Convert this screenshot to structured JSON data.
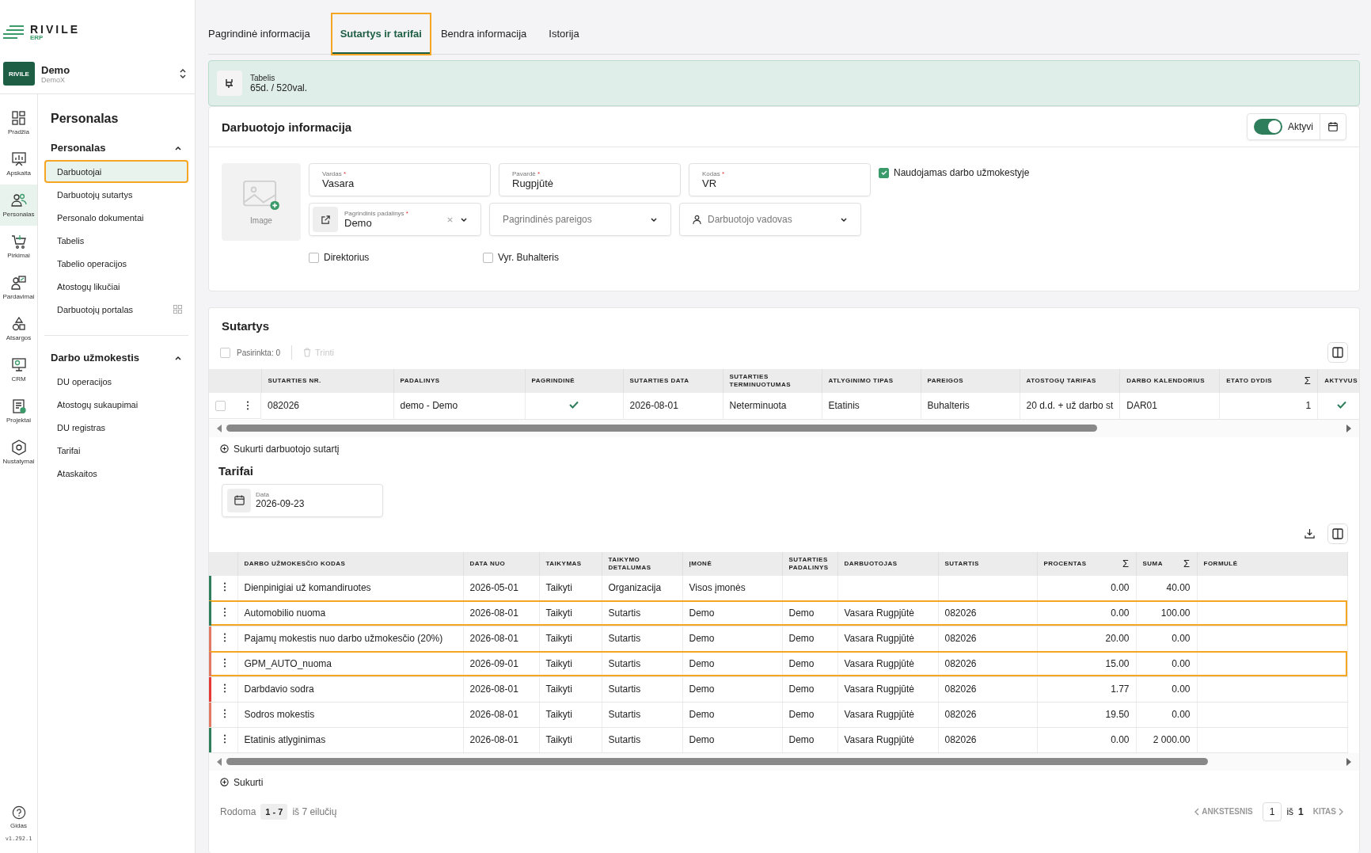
{
  "app": {
    "logo": "RIVILE",
    "logo_sub": "ERP"
  },
  "company": {
    "name": "Demo",
    "sub": "DemoX",
    "badge": "RIVILE"
  },
  "rail": [
    {
      "label": "Pradžia",
      "selected": false
    },
    {
      "label": "Apskaita",
      "selected": false
    },
    {
      "label": "Personalas",
      "selected": true
    },
    {
      "label": "Pirkimai",
      "selected": false
    },
    {
      "label": "Pardavimai",
      "selected": false
    },
    {
      "label": "Atsargos",
      "selected": false
    },
    {
      "label": "CRM",
      "selected": false
    },
    {
      "label": "Projektai",
      "selected": false
    },
    {
      "label": "Nustatymai",
      "selected": false
    }
  ],
  "help": {
    "label": "Gidas",
    "version": "v1.292.1"
  },
  "nav": {
    "title": "Personalas",
    "sections": [
      {
        "title": "Personalas",
        "expanded": true,
        "items": [
          {
            "label": "Darbuotojai",
            "selected": true,
            "highlighted": true,
            "grid_icon": false
          },
          {
            "label": "Darbuotojų sutartys",
            "selected": false,
            "highlighted": false,
            "grid_icon": false
          },
          {
            "label": "Personalo dokumentai",
            "selected": false,
            "highlighted": false,
            "grid_icon": false
          },
          {
            "label": "Tabelis",
            "selected": false,
            "highlighted": false,
            "grid_icon": false
          },
          {
            "label": "Tabelio operacijos",
            "selected": false,
            "highlighted": false,
            "grid_icon": false
          },
          {
            "label": "Atostogų likučiai",
            "selected": false,
            "highlighted": false,
            "grid_icon": false
          },
          {
            "label": "Darbuotojų portalas",
            "selected": false,
            "highlighted": false,
            "grid_icon": true
          }
        ]
      },
      {
        "title": "Darbo užmokestis",
        "expanded": true,
        "items": [
          {
            "label": "DU operacijos",
            "selected": false,
            "highlighted": false,
            "grid_icon": false
          },
          {
            "label": "Atostogų sukaupimai",
            "selected": false,
            "highlighted": false,
            "grid_icon": false
          },
          {
            "label": "DU registras",
            "selected": false,
            "highlighted": false,
            "grid_icon": false
          },
          {
            "label": "Tarifai",
            "selected": false,
            "highlighted": false,
            "grid_icon": false
          },
          {
            "label": "Ataskaitos",
            "selected": false,
            "highlighted": false,
            "grid_icon": false
          }
        ]
      }
    ]
  },
  "tabs": [
    {
      "label": "Pagrindinė informacija",
      "selected": false,
      "highlighted": false
    },
    {
      "label": "Sutartys ir tarifai",
      "selected": true,
      "highlighted": true
    },
    {
      "label": "Bendra informacija",
      "selected": false,
      "highlighted": false
    },
    {
      "label": "Istorija",
      "selected": false,
      "highlighted": false
    }
  ],
  "banner": {
    "title": "Tabelis",
    "value": "65d. / 520val."
  },
  "employee": {
    "title": "Darbuotojo informacija",
    "active_toggle": {
      "label": "Aktyvi",
      "on": true
    },
    "image_label": "Image",
    "fields": [
      {
        "label": "Vardas",
        "mark": "*",
        "value": "Vasara"
      },
      {
        "label": "Pavardė",
        "mark": "*",
        "value": "Rugpjūtė"
      },
      {
        "label": "Kodas",
        "mark": "*",
        "value": "VR"
      }
    ],
    "payroll_checkbox": {
      "label": "Naudojamas darbo užmokestyje",
      "checked": true
    },
    "department": {
      "label": "Pagrindinis padalinys",
      "mark": "*",
      "value": "Demo"
    },
    "position": {
      "placeholder": "Pagrindinės pareigos"
    },
    "manager": {
      "placeholder": "Darbuotojo vadovas"
    },
    "checkboxes": [
      {
        "label": "Direktorius",
        "checked": false
      },
      {
        "label": "Vyr. Buhalteris",
        "checked": false
      }
    ]
  },
  "contracts": {
    "title": "Sutartys",
    "selected_count": "Pasirinkta: 0",
    "select_all": {
      "checked": false
    },
    "delete": {
      "label": "Trinti",
      "disabled": true
    },
    "columns": [
      {
        "label": "SUTARTIES NR."
      },
      {
        "label": "PADALINYS"
      },
      {
        "label": "PAGRINDINĖ"
      },
      {
        "label": "SUTARTIES DATA"
      },
      {
        "label": "SUTARTIES TERMINUOTUMAS"
      },
      {
        "label": "ATLYGINIMO TIPAS"
      },
      {
        "label": "PAREIGOS"
      },
      {
        "label": "ATOSTOGŲ TARIFAS"
      },
      {
        "label": "DARBO KALENDORIUS"
      },
      {
        "label": "ETATO DYDIS",
        "sum_mark": "Σ"
      },
      {
        "label": "AKTYVUS"
      }
    ],
    "rows": [
      {
        "checked": false,
        "number": "082026",
        "department": "demo - Demo",
        "main": true,
        "date": "2026-08-01",
        "term": "Neterminuota",
        "pay_type": "Etatinis",
        "position": "Buhalteris",
        "vacation_rate": "20 d.d. + už darbo st",
        "calendar": "DAR01",
        "fte": "1",
        "active": true
      }
    ],
    "create_link": "Sukurti darbuotojo sutartį"
  },
  "rates": {
    "title": "Tarifai",
    "date_field": {
      "label": "Data",
      "value": "2026-09-23"
    },
    "columns": [
      {
        "label": "DARBO UŽMOKESČIO KODAS"
      },
      {
        "label": "DATA NUO"
      },
      {
        "label": "TAIKYMAS"
      },
      {
        "label": "TAIKYMO DETALUMAS"
      },
      {
        "label": "ĮMONĖ"
      },
      {
        "label": "SUTARTIES PADALINYS"
      },
      {
        "label": "DARBUOTOJAS"
      },
      {
        "label": "SUTARTIS"
      },
      {
        "label": "PROCENTAS",
        "sum_mark": "Σ"
      },
      {
        "label": "SUMA",
        "sum_mark": "Σ"
      },
      {
        "label": "FORMULĖ"
      }
    ],
    "rows": [
      {
        "color": "#2e7d5b",
        "highlighted": false,
        "cells": [
          "Dienpinigiai už komandiruotes",
          "2026-05-01",
          "Taikyti",
          "Organizacija",
          "Visos įmonės",
          "",
          "",
          "",
          "0.00",
          "40.00",
          ""
        ]
      },
      {
        "color": "#2e7d5b",
        "highlighted": true,
        "cells": [
          "Automobilio nuoma",
          "2026-08-01",
          "Taikyti",
          "Sutartis",
          "Demo",
          "Demo",
          "Vasara Rugpjūtė",
          "082026",
          "0.00",
          "100.00",
          ""
        ]
      },
      {
        "color": "#e07a64",
        "highlighted": false,
        "cells": [
          "Pajamų mokestis nuo darbo užmokesčio (20%)",
          "2026-08-01",
          "Taikyti",
          "Sutartis",
          "Demo",
          "Demo",
          "Vasara Rugpjūtė",
          "082026",
          "20.00",
          "0.00",
          ""
        ]
      },
      {
        "color": "#e07a64",
        "highlighted": true,
        "cells": [
          "GPM_AUTO_nuoma",
          "2026-09-01",
          "Taikyti",
          "Sutartis",
          "Demo",
          "Demo",
          "Vasara Rugpjūtė",
          "082026",
          "15.00",
          "0.00",
          ""
        ]
      },
      {
        "color": "#e53935",
        "highlighted": false,
        "cells": [
          "Darbdavio sodra",
          "2026-08-01",
          "Taikyti",
          "Sutartis",
          "Demo",
          "Demo",
          "Vasara Rugpjūtė",
          "082026",
          "1.77",
          "0.00",
          ""
        ]
      },
      {
        "color": "#e07a64",
        "highlighted": false,
        "cells": [
          "Sodros mokestis",
          "2026-08-01",
          "Taikyti",
          "Sutartis",
          "Demo",
          "Demo",
          "Vasara Rugpjūtė",
          "082026",
          "19.50",
          "0.00",
          ""
        ]
      },
      {
        "color": "#2e7d5b",
        "highlighted": false,
        "cells": [
          "Etatinis atlyginimas",
          "2026-08-01",
          "Taikyti",
          "Sutartis",
          "Demo",
          "Demo",
          "Vasara Rugpjūtė",
          "082026",
          "0.00",
          "2 000.00",
          ""
        ]
      }
    ],
    "create_link": "Sukurti",
    "pagination": {
      "showing": "Rodoma",
      "range": "1 - 7",
      "total": "iš 7 eilučių",
      "prev": {
        "label": "ANKSTESNIS",
        "disabled": true
      },
      "page": "1",
      "of": "iš",
      "pages": "1",
      "next": {
        "label": "KITAS",
        "disabled": true
      }
    }
  }
}
